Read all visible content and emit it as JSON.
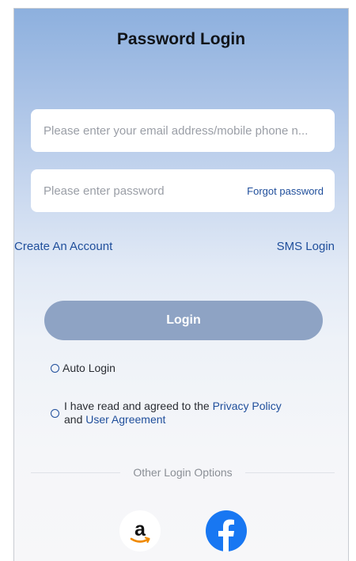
{
  "header": {
    "title": "Password Login"
  },
  "form": {
    "email_placeholder": "Please enter your email address/mobile phone n...",
    "password_placeholder": "Please enter password",
    "forgot_password": "Forgot password"
  },
  "links": {
    "create_account": "Create An Account",
    "sms_login": "SMS Login"
  },
  "login_button": "Login",
  "options": {
    "auto_login": "Auto Login",
    "agreement_prefix": "I have read and agreed to the ",
    "privacy_policy": "Privacy Policy",
    "agreement_and": " and ",
    "user_agreement": "User Agreement"
  },
  "other_login": {
    "label": "Other Login Options",
    "providers": [
      "amazon-icon",
      "facebook-icon"
    ]
  },
  "colors": {
    "accent": "#1f4e9b",
    "login_button": "#8ea3c4",
    "facebook": "#1877f2",
    "amazon_smile": "#f08a00"
  }
}
